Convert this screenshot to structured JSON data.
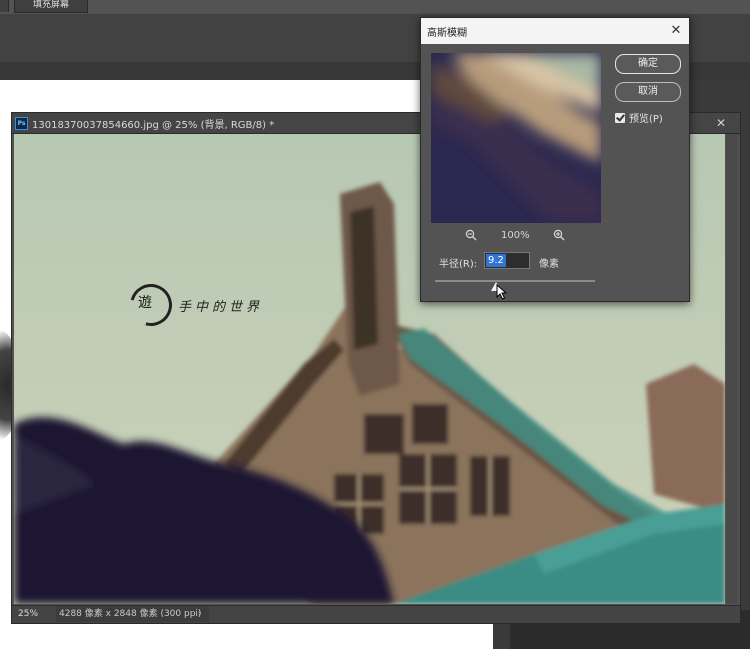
{
  "app": {
    "top_tab_label": "填充屏幕"
  },
  "document": {
    "title": "13018370037854660.jpg @ 25% (背景, RGB/8) *",
    "close_glyph": "✕",
    "ps_icon_text": "Ps",
    "status": {
      "zoom": "25%",
      "info": "4288 像素 x 2848 像素 (300 ppi)",
      "arrow": "›"
    },
    "watermark": {
      "ring_char": "遊",
      "text": "手中的世界"
    }
  },
  "dialog": {
    "title": "高斯模糊",
    "close_glyph": "✕",
    "ok_label": "确定",
    "cancel_label": "取消",
    "preview_label": "预览(P)",
    "preview_checked": true,
    "zoom_out_icon": "zoom-out-icon",
    "zoom_in_icon": "zoom-in-icon",
    "zoom_level": "100%",
    "radius_label": "半径(R):",
    "radius_value": "9.2",
    "radius_unit": "像素",
    "slider_fraction": 0.38
  },
  "colors": {
    "ui_dark": "#535353",
    "dialog_title_bg": "#f4f4f4",
    "selection_blue": "#2f73d4",
    "sky": "#c7d3bc",
    "teal_tiles": "#3f8f84"
  }
}
